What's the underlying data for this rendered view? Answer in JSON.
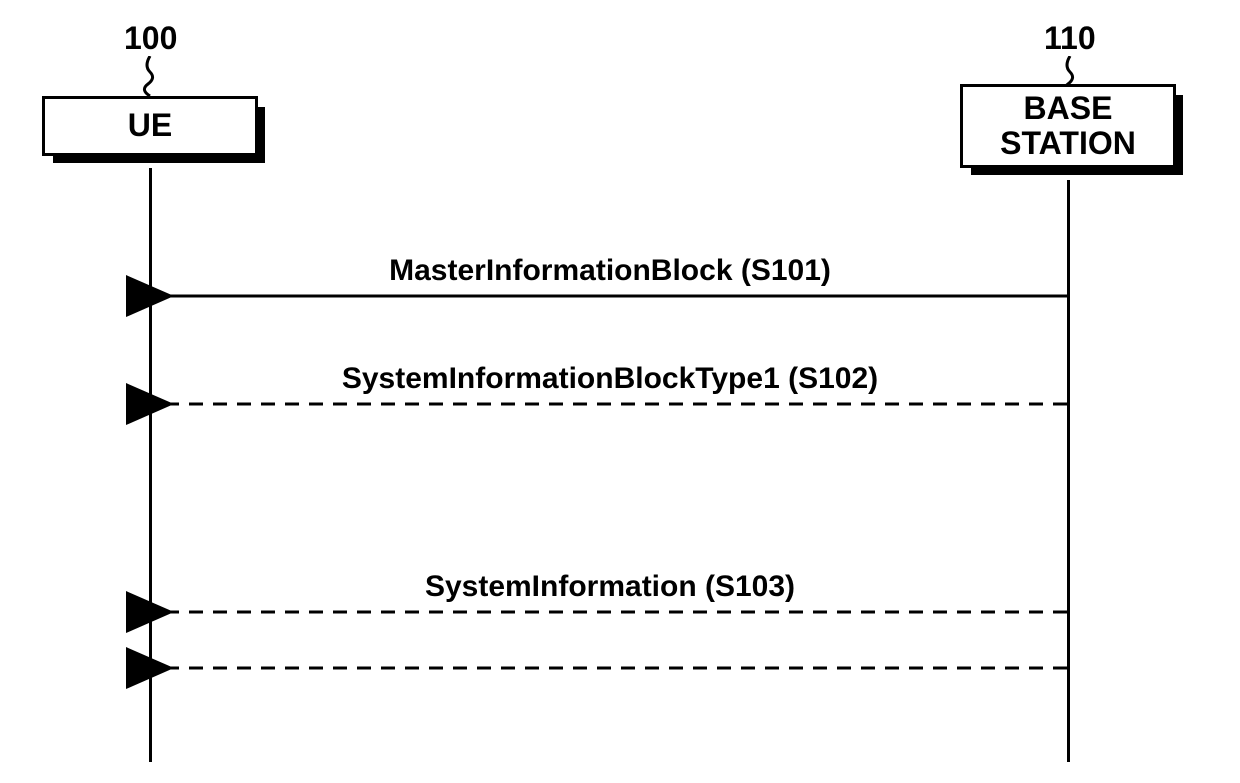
{
  "actors": {
    "ue": {
      "ref": "100",
      "label": "UE"
    },
    "bs": {
      "ref": "110",
      "label": "BASE\nSTATION"
    }
  },
  "messages": {
    "m1": {
      "label": "MasterInformationBlock (S101)",
      "step": "S101",
      "style": "solid",
      "dir": "left"
    },
    "m2": {
      "label": "SystemInformationBlockType1 (S102)",
      "step": "S102",
      "style": "dashed",
      "dir": "left"
    },
    "m3": {
      "label": "SystemInformation (S103)",
      "step": "S103",
      "style": "dashed",
      "dir": "left"
    },
    "m4": {
      "label": "",
      "step": "",
      "style": "dashed",
      "dir": "left"
    }
  },
  "diagram": {
    "type": "sequence",
    "description": "UE receives system information broadcast messages from Base Station"
  }
}
